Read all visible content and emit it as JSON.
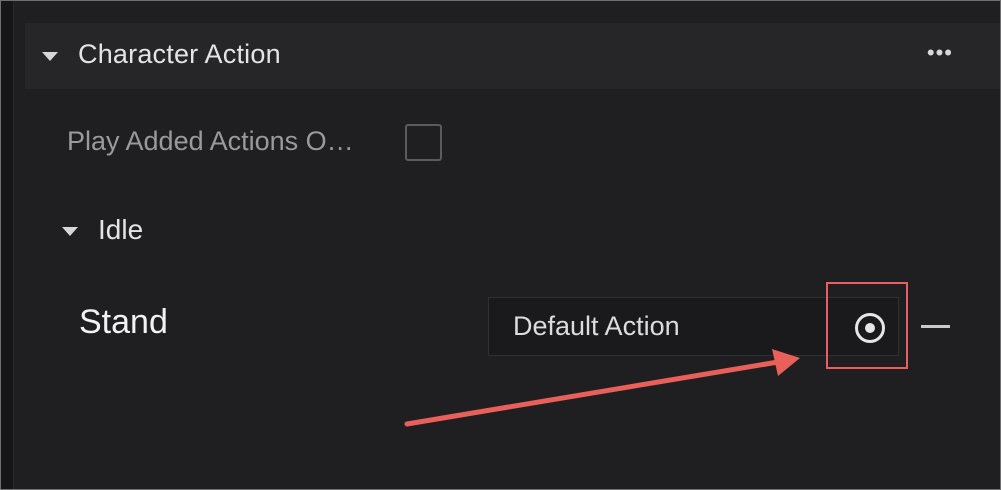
{
  "panel": {
    "section_title": "Character Action",
    "more_label": "•••",
    "setting_label": "Play Added Actions O…",
    "setting_checked": false,
    "group_title": "Idle",
    "row": {
      "label": "Stand",
      "value": "Default Action"
    }
  },
  "annotation": {
    "highlight_color": "#e9605a",
    "target": "target-icon"
  }
}
